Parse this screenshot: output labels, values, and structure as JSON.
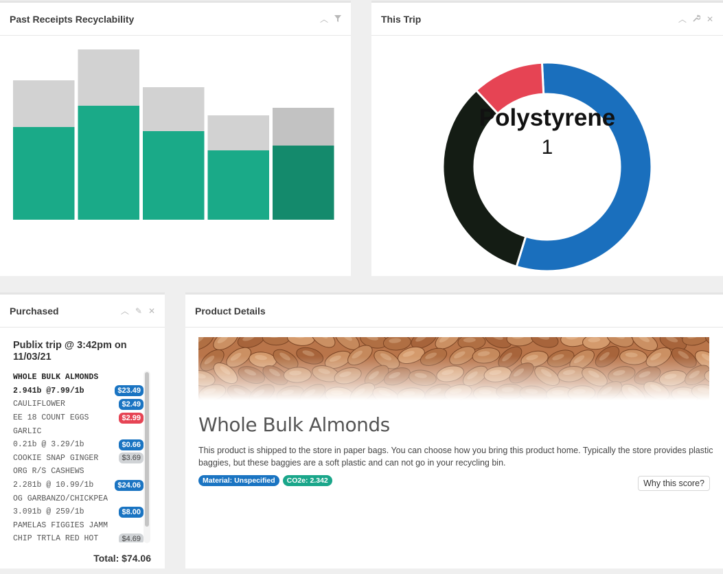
{
  "panels": {
    "receipts": {
      "title": "Past Receipts Recyclability"
    },
    "trip": {
      "title": "This Trip"
    },
    "purchased": {
      "title": "Purchased"
    },
    "details": {
      "title": "Product Details"
    }
  },
  "icons": {
    "collapse": "chevron-up-icon",
    "filter": "filter-icon",
    "wrench": "wrench-icon",
    "pencil": "pencil-icon",
    "close": "close-icon"
  },
  "colors": {
    "recyclable": "#1aaa88",
    "recyclable_last": "#148a6c",
    "nonrecyclable": "#d2d2d2",
    "nonrecyclable_last": "#c2c2c2",
    "blue": "#1a6fbd",
    "red": "#e64454",
    "dark": "#141c14"
  },
  "chart_data": [
    {
      "type": "bar",
      "title": "",
      "categories": [
        "",
        "",
        "",
        "",
        ""
      ],
      "series": [
        {
          "values": [
            135,
            166,
            129,
            101,
            108
          ]
        },
        {
          "values": [
            68,
            82,
            64,
            51,
            55
          ]
        }
      ],
      "stacked": true,
      "ylim": [
        0,
        250
      ],
      "axes": false,
      "grid": false
    },
    {
      "type": "pie",
      "donut": true,
      "center_label": "Polystyrene",
      "center_value": "1",
      "slices": [
        {
          "value": 5,
          "color": "#1a6fbd"
        },
        {
          "value": 3,
          "color": "#141c14"
        },
        {
          "value": 1,
          "color": "#e64454"
        }
      ]
    }
  ],
  "purchased": {
    "trip_title": "Publix trip @ 3:42pm on 11/03/21",
    "lines": [
      {
        "text": "WHOLE BULK ALMONDS",
        "badge": "",
        "bold": true
      },
      {
        "text": "2.941b @7.99/1b",
        "badge": "$23.49",
        "badge_color": "blue",
        "bold": true
      },
      {
        "text": "CAULIFLOWER",
        "badge": "$2.49",
        "badge_color": "blue"
      },
      {
        "text": "EE 18 COUNT EGGS",
        "badge": "$2.99",
        "badge_color": "red"
      },
      {
        "text": "GARLIC",
        "badge": ""
      },
      {
        "text": "0.21b @ 3.29/1b",
        "badge": "$0.66",
        "badge_color": "blue"
      },
      {
        "text": "COOKIE SNAP GINGER",
        "badge": "$3.69",
        "badge_color": "grey"
      },
      {
        "text": "ORG R/S CASHEWS",
        "badge": ""
      },
      {
        "text": "2.281b @ 10.99/1b",
        "badge": "$24.06",
        "badge_color": "blue"
      },
      {
        "text": "OG GARBANZO/CHICKPEA",
        "badge": ""
      },
      {
        "text": "3.091b @ 259/1b",
        "badge": "$8.00",
        "badge_color": "blue"
      },
      {
        "text": "PAMELAS FIGGIES JAMM",
        "badge": ""
      },
      {
        "text": "CHIP TRTLA RED HOT",
        "badge": "$4.69",
        "badge_color": "grey"
      }
    ],
    "total": "Total: $74.06"
  },
  "details": {
    "product_name": "Whole Bulk Almonds",
    "description": "This product is shipped to the store in paper bags. You can choose how you bring this product home. Typically the store provides plastic baggies, but these baggies are a soft plastic and can not go in your recycling bin.",
    "material_chip": "Material: Unspecified",
    "co2_chip": "CO2e: 2.342",
    "why_button": "Why this score?"
  }
}
